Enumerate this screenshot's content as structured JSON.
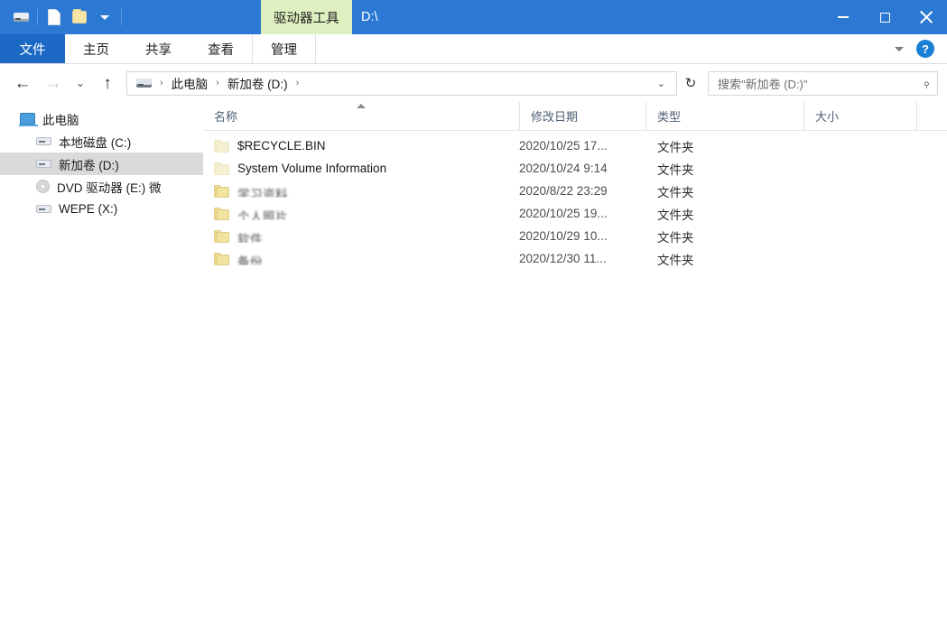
{
  "titlebar": {
    "quick_access": [
      {
        "name": "drive-icon",
        "label": ""
      },
      {
        "name": "properties-icon",
        "label": ""
      },
      {
        "name": "new-folder-icon",
        "label": ""
      },
      {
        "name": "customize-qat-chevron-icon",
        "label": ""
      }
    ],
    "contextual_tab": "驱动器工具",
    "window_title": "D:\\",
    "minimize_label": "最小化",
    "maximize_label": "最大化",
    "close_label": "关闭"
  },
  "ribbon": {
    "file_tab": "文件",
    "tabs": [
      {
        "label": "主页"
      },
      {
        "label": "共享"
      },
      {
        "label": "查看"
      },
      {
        "label": "管理"
      }
    ],
    "expand_label": "",
    "help_label": "?"
  },
  "address": {
    "back_glyph": "←",
    "forward_glyph": "→",
    "recent_glyph": "⌄",
    "up_glyph": "↑",
    "crumbs": [
      {
        "label": "此电脑"
      },
      {
        "label": "新加卷 (D:)"
      }
    ],
    "separator": "›",
    "dropdown_glyph": "⌄",
    "refresh_glyph": "↻"
  },
  "search": {
    "placeholder": "搜索\"新加卷 (D:)\"",
    "icon": "⌕"
  },
  "sidebar": {
    "items": [
      {
        "label": "此电脑",
        "icon": "computer-icon",
        "indent": false,
        "selected": false
      },
      {
        "label": "本地磁盘 (C:)",
        "icon": "hdd-icon",
        "indent": true,
        "selected": false
      },
      {
        "label": "新加卷 (D:)",
        "icon": "hdd-icon",
        "indent": true,
        "selected": true
      },
      {
        "label": "DVD 驱动器 (E:) 微",
        "icon": "dvd-icon",
        "indent": true,
        "selected": false
      },
      {
        "label": "WEPE (X:)",
        "icon": "hdd-icon",
        "indent": true,
        "selected": false
      }
    ]
  },
  "filelist": {
    "columns": [
      {
        "key": "name",
        "label": "名称",
        "sorted": "asc"
      },
      {
        "key": "date",
        "label": "修改日期",
        "sorted": ""
      },
      {
        "key": "type",
        "label": "类型",
        "sorted": ""
      },
      {
        "key": "size",
        "label": "大小",
        "sorted": ""
      }
    ],
    "rows": [
      {
        "name": "$RECYCLE.BIN",
        "redacted": false,
        "dim": true,
        "date": "2020/10/25 17...",
        "type": "文件夹",
        "size": ""
      },
      {
        "name": "System Volume Information",
        "redacted": false,
        "dim": true,
        "date": "2020/10/24 9:14",
        "type": "文件夹",
        "size": ""
      },
      {
        "name": "学习资料",
        "redacted": true,
        "dim": false,
        "date": "2020/8/22 23:29",
        "type": "文件夹",
        "size": ""
      },
      {
        "name": "个人照片",
        "redacted": true,
        "dim": false,
        "date": "2020/10/25 19...",
        "type": "文件夹",
        "size": ""
      },
      {
        "name": "软件",
        "redacted": true,
        "dim": false,
        "date": "2020/10/29 10...",
        "type": "文件夹",
        "size": ""
      },
      {
        "name": "备份",
        "redacted": true,
        "dim": false,
        "date": "2020/12/30 11...",
        "type": "文件夹",
        "size": ""
      }
    ]
  },
  "colors": {
    "titlebar_blue": "#2b79d3",
    "file_tab_blue": "#1b69c4",
    "contextual_green": "#dff0c0",
    "selection_grey": "#dadada",
    "column_header_text": "#4e5f73",
    "folder_yellow": "#f2e3a0"
  }
}
